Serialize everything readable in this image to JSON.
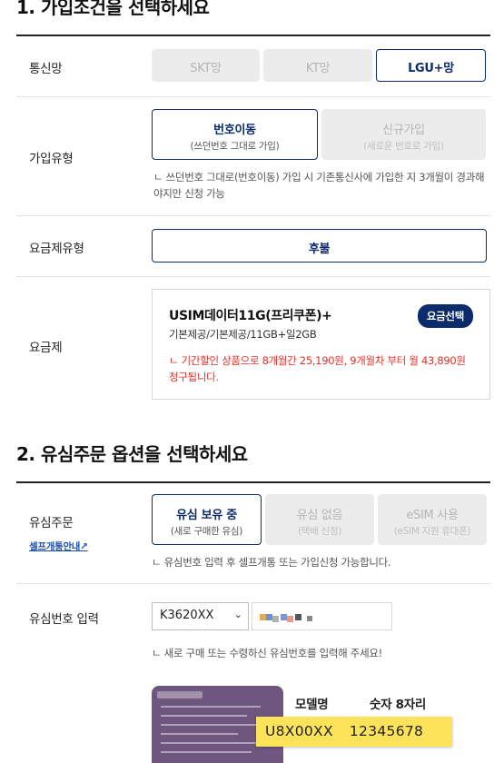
{
  "section1": {
    "title": "1. 가입조건을 선택하세요",
    "network": {
      "label": "통신망",
      "options": [
        "SKT망",
        "KT망",
        "LGU+망"
      ],
      "selected": "LGU+망"
    },
    "join_type": {
      "label": "가입유형",
      "options": [
        {
          "main": "번호이동",
          "sub": "(쓰던번호 그대로 가입)"
        },
        {
          "main": "신규가입",
          "sub": "(새로운 번호로 가입)"
        }
      ],
      "selected": "번호이동",
      "note": "ㄴ 쓰던번호 그대로(번호이동) 가입 시 기존통신사에 가입한 지 3개월이 경과해야지만 신청 가능"
    },
    "plan_type": {
      "label": "요금제유형",
      "option": "후불"
    },
    "plan": {
      "label": "요금제",
      "name": "USIM데이터11G(프리쿠폰)+",
      "desc": "기본제공/기본제공/11GB+일2GB",
      "button": "요금선택",
      "note": "ㄴ 기간할인 상품으로 8개월간 25,190원, 9개월차 부터 월 43,890원 청구됩니다."
    }
  },
  "section2": {
    "title": "2. 유심주문 옵션을 선택하세요",
    "usim_order": {
      "label": "유심주문",
      "link": "셀프개통안내↗",
      "options": [
        {
          "main": "유심 보유 중",
          "sub": "(새로 구매한 유심)"
        },
        {
          "main": "유심 없음",
          "sub": "(택배 신청)"
        },
        {
          "main": "eSIM 사용",
          "sub": "(eSIM 지원 휴대폰)"
        }
      ],
      "selected": "유심 보유 중",
      "note": "ㄴ 유심번호 입력 후 셀프개통 또는 가입신청 가능합니다."
    },
    "usim_number": {
      "label": "유심번호 입력",
      "select_value": "K3620XX",
      "note": "ㄴ 새로 구매 또는 수령하신 유심번호를 입력해 주세요!"
    },
    "guide": {
      "model_label": "모델명",
      "digits_label": "숫자 8자리",
      "model_value": "U8X00XX",
      "digits_value": "12345678"
    }
  },
  "colors": {
    "accent": "#0b2b6b",
    "warning": "#e2332a",
    "highlight": "#fde35a",
    "card": "#6f567f"
  }
}
